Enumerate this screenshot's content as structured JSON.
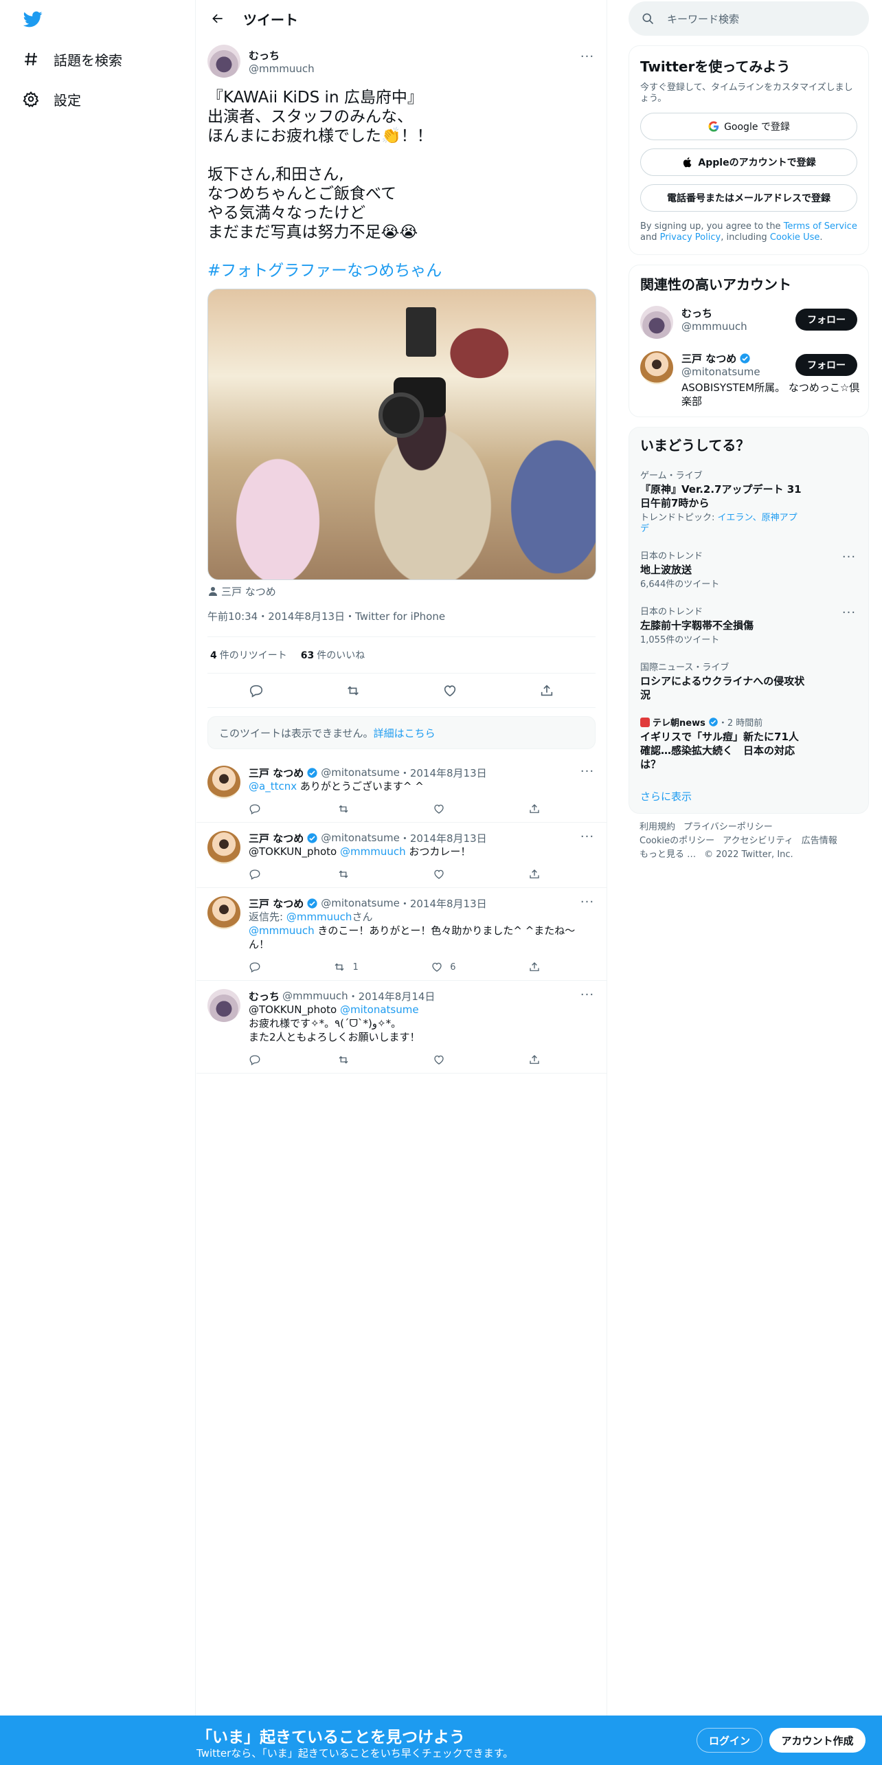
{
  "nav": {
    "explore_label": "話題を検索",
    "settings_label": "設定"
  },
  "header": {
    "title": "ツイート"
  },
  "main_tweet": {
    "author_name": "むっち",
    "author_handle": "@mmmuuch",
    "text": "『KAWAii KiDS in 広島府中』\n出演者、スタッフのみんな、\nほんまにお疲れ様でした👏！！\n\n坂下さん,和田さん,\nなつめちゃんとご飯食べて\nやる気満々なったけど\nまだまだ写真は努力不足😭😭",
    "hashtag": "#フォトグラファーなつめちゃん",
    "tagged_user": "三戸 なつめ",
    "meta": "午前10:34・2014年8月13日・Twitter for iPhone",
    "retweets_count": "4",
    "retweets_label": "件のリツイート",
    "likes_count": "63",
    "likes_label": "件のいいね"
  },
  "unavailable": {
    "text": "このツイートは表示できません。",
    "link": "詳細はこちら"
  },
  "replies": [
    {
      "name": "三戸 なつめ",
      "handle": "@mitonatsume",
      "date": "・2014年8月13日",
      "mention": "@a_ttcnx",
      "text": " ありがとうございます^ ^",
      "retweets": "",
      "likes": ""
    },
    {
      "name": "三戸 なつめ",
      "handle": "@mitonatsume",
      "date": "・2014年8月13日",
      "prefix": "@TOKKUN_photo ",
      "mention": "@mmmuuch",
      "text": " おつカレー！",
      "retweets": "",
      "likes": ""
    },
    {
      "name": "三戸 なつめ",
      "handle": "@mitonatsume",
      "date": "・2014年8月13日",
      "reply_to_label": "返信先: ",
      "reply_to": "@mmmuuch",
      "reply_to_suffix": "さん",
      "mention": "@mmmuuch",
      "text": " きのこー！ありがとー！色々助かりました^ ^またね〜ん！",
      "retweets": "1",
      "likes": "6"
    },
    {
      "name": "むっち",
      "handle": "@mmmuuch",
      "date": "・2014年8月14日",
      "prefix": "@TOKKUN_photo ",
      "mention": "@mitonatsume",
      "text": "\nお疲れ様です✧*。٩(ˊᗜˋ*)و✧*。\nまた2人ともよろしくお願いします！",
      "retweets": "",
      "likes": ""
    }
  ],
  "search": {
    "placeholder": "キーワード検索"
  },
  "signup": {
    "title": "Twitterを使ってみよう",
    "subtitle": "今すぐ登録して、タイムラインをカスタマイズしましょう。",
    "google": "Google で登録",
    "apple": "Appleのアカウントで登録",
    "phone": "電話番号またはメールアドレスで登録",
    "terms_prefix": "By signing up, you agree to the ",
    "terms_link": "Terms of Service",
    "terms_and": " and ",
    "privacy_link": "Privacy Policy",
    "terms_including": ", including ",
    "cookie_link": "Cookie Use",
    "terms_end": "."
  },
  "related": {
    "title": "関連性の高いアカウント",
    "accounts": [
      {
        "name": "むっち",
        "handle": "@mmmuuch",
        "bio": "",
        "follow": "フォロー"
      },
      {
        "name": "三戸 なつめ",
        "handle": "@mitonatsume",
        "bio": "ASOBISYSTEM所属。 なつめっこ☆倶楽部",
        "follow": "フォロー"
      }
    ]
  },
  "trends": {
    "title": "いまどうしてる？",
    "items": [
      {
        "context": "ゲーム・ライブ",
        "title": "『原神』Ver.2.7アップデート 31日午前7時から",
        "sub_prefix": "トレンドトピック: ",
        "sub_links": "イエラン、原神アプデ"
      },
      {
        "context": "日本のトレンド",
        "title": "地上波放送",
        "sub": "6,644件のツイート"
      },
      {
        "context": "日本のトレンド",
        "title": "左膝前十字靱帯不全損傷",
        "sub": "1,055件のツイート"
      },
      {
        "context": "国際ニュース・ライブ",
        "title": "ロシアによるウクライナへの侵攻状況"
      },
      {
        "context_pub": "テレ朝news",
        "context_time": "・2 時間前",
        "title": "イギリスで「サル痘」新たに71人確認…感染拡大続く　日本の対応は？"
      }
    ],
    "show_more": "さらに表示"
  },
  "footer": {
    "line1": [
      "利用規約",
      "プライバシーポリシー"
    ],
    "line2": [
      "Cookieのポリシー",
      "アクセシビリティ",
      "広告情報"
    ],
    "more": "もっと見る …",
    "copyright": "© 2022 Twitter, Inc."
  },
  "bottombar": {
    "headline": "「いま」起きていることを見つけよう",
    "sub": "Twitterなら、「いま」起きていることをいち早くチェックできます。",
    "login": "ログイン",
    "signup": "アカウント作成"
  },
  "colors": {
    "accent": "#1d9bf0",
    "text": "#0f1419",
    "muted": "#536471"
  }
}
